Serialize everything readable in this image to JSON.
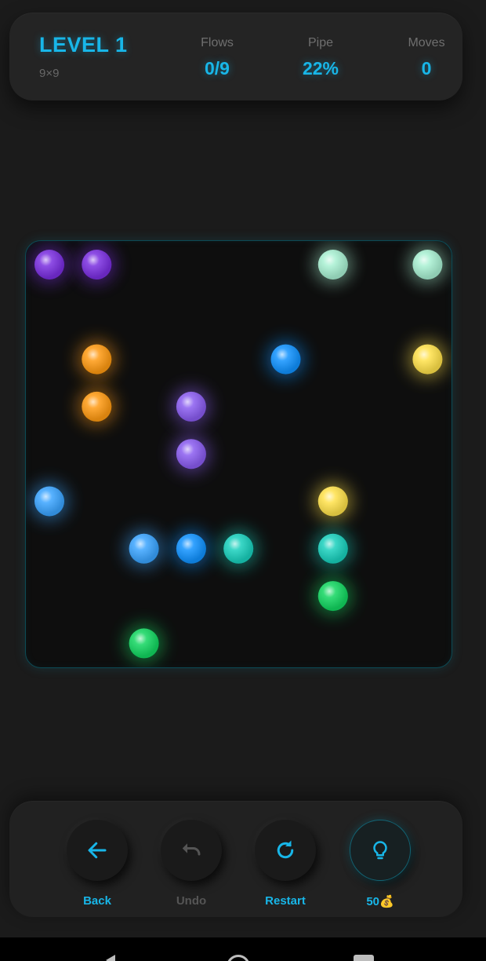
{
  "hud": {
    "level_title": "LEVEL 1",
    "grid_size": "9×9",
    "stats": [
      {
        "label": "Flows",
        "value": "0/9"
      },
      {
        "label": "Pipe",
        "value": "22%"
      },
      {
        "label": "Moves",
        "value": "0"
      }
    ]
  },
  "board": {
    "rows": 9,
    "cols": 9,
    "dots": [
      {
        "row": 0,
        "col": 0,
        "color": "#7a2ee0"
      },
      {
        "row": 0,
        "col": 1,
        "color": "#7a2ee0"
      },
      {
        "row": 0,
        "col": 6,
        "color": "#a8f0d2"
      },
      {
        "row": 0,
        "col": 8,
        "color": "#a8f0d2"
      },
      {
        "row": 2,
        "col": 1,
        "color": "#ff9a12"
      },
      {
        "row": 2,
        "col": 5,
        "color": "#1092ff"
      },
      {
        "row": 2,
        "col": 8,
        "color": "#ffe14a"
      },
      {
        "row": 3,
        "col": 1,
        "color": "#ff9a12"
      },
      {
        "row": 3,
        "col": 3,
        "color": "#8a5cf0"
      },
      {
        "row": 4,
        "col": 3,
        "color": "#8a5cf0"
      },
      {
        "row": 5,
        "col": 0,
        "color": "#3aa4ff"
      },
      {
        "row": 5,
        "col": 6,
        "color": "#ffe14a"
      },
      {
        "row": 6,
        "col": 2,
        "color": "#3aa4ff"
      },
      {
        "row": 6,
        "col": 3,
        "color": "#1092ff"
      },
      {
        "row": 6,
        "col": 4,
        "color": "#19d0bd"
      },
      {
        "row": 6,
        "col": 6,
        "color": "#19d0bd"
      },
      {
        "row": 7,
        "col": 6,
        "color": "#12d660"
      },
      {
        "row": 8,
        "col": 2,
        "color": "#12d660"
      }
    ]
  },
  "controls": [
    {
      "label": "Back",
      "icon": "arrow-left-icon",
      "enabled": true
    },
    {
      "label": "Undo",
      "icon": "undo-icon",
      "enabled": false
    },
    {
      "label": "Restart",
      "icon": "restart-icon",
      "enabled": true
    },
    {
      "label": "50💰",
      "icon": "lightbulb-icon",
      "enabled": true
    }
  ],
  "colors": {
    "accent": "#18b6e8",
    "background": "#1b1b1b",
    "board_background": "#0e0e0e",
    "disabled": "#555555"
  }
}
